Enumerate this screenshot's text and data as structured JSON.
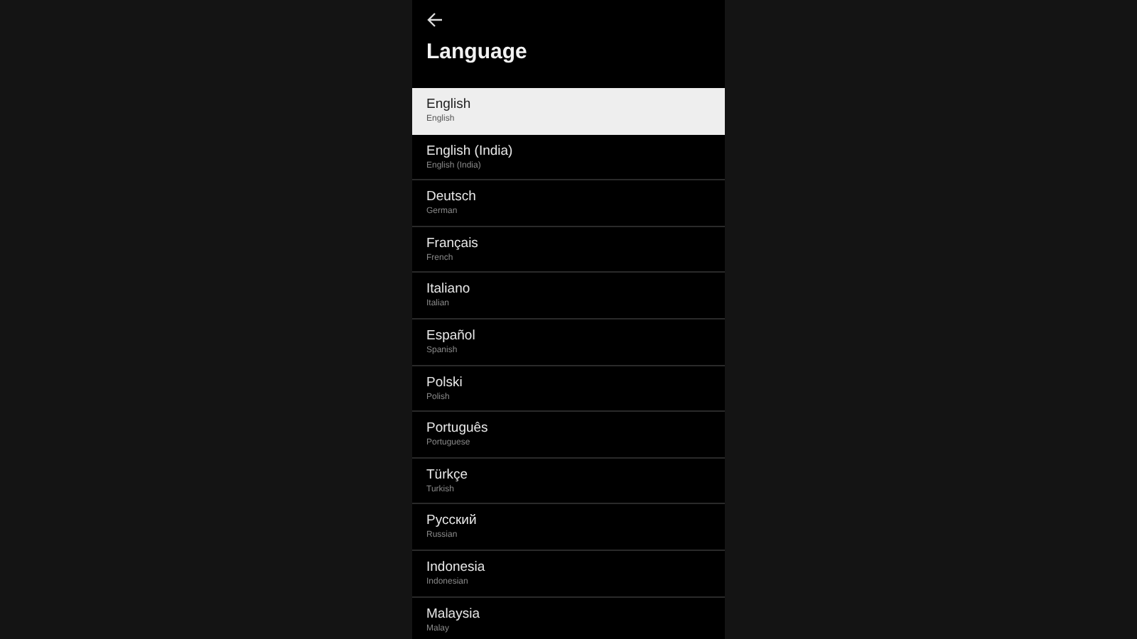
{
  "screen": {
    "title": "Language"
  },
  "languages": [
    {
      "name": "English",
      "subtitle": "English",
      "selected": true
    },
    {
      "name": "English (India)",
      "subtitle": "English (India)",
      "selected": false
    },
    {
      "name": "Deutsch",
      "subtitle": "German",
      "selected": false
    },
    {
      "name": "Français",
      "subtitle": "French",
      "selected": false
    },
    {
      "name": "Italiano",
      "subtitle": "Italian",
      "selected": false
    },
    {
      "name": "Español",
      "subtitle": "Spanish",
      "selected": false
    },
    {
      "name": "Polski",
      "subtitle": "Polish",
      "selected": false
    },
    {
      "name": "Português",
      "subtitle": "Portuguese",
      "selected": false
    },
    {
      "name": "Türkçe",
      "subtitle": "Turkish",
      "selected": false
    },
    {
      "name": "Русский",
      "subtitle": "Russian",
      "selected": false
    },
    {
      "name": "Indonesia",
      "subtitle": "Indonesian",
      "selected": false
    },
    {
      "name": "Malaysia",
      "subtitle": "Malay",
      "selected": false
    }
  ]
}
